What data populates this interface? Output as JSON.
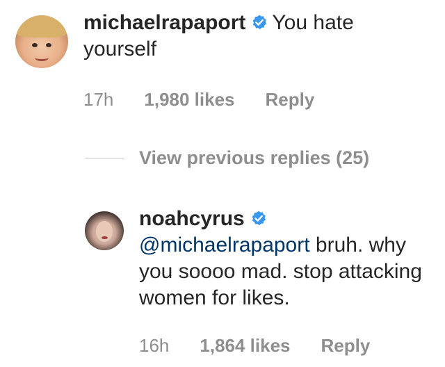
{
  "comments": [
    {
      "username": "michaelrapaport",
      "verified": true,
      "text": "You hate yourself",
      "time": "17h",
      "likes": "1,980 likes",
      "reply_label": "Reply"
    },
    {
      "username": "noahcyrus",
      "verified": true,
      "mention": "@michaelrapaport",
      "text": " bruh. why you soooo mad.  stop attacking women for likes.",
      "time": "16h",
      "likes": "1,864 likes",
      "reply_label": "Reply"
    }
  ],
  "view_previous_replies": "View previous replies (25)",
  "colors": {
    "text": "#262626",
    "meta": "#8e8e8e",
    "mention": "#003569",
    "verified": "#3897f0"
  }
}
